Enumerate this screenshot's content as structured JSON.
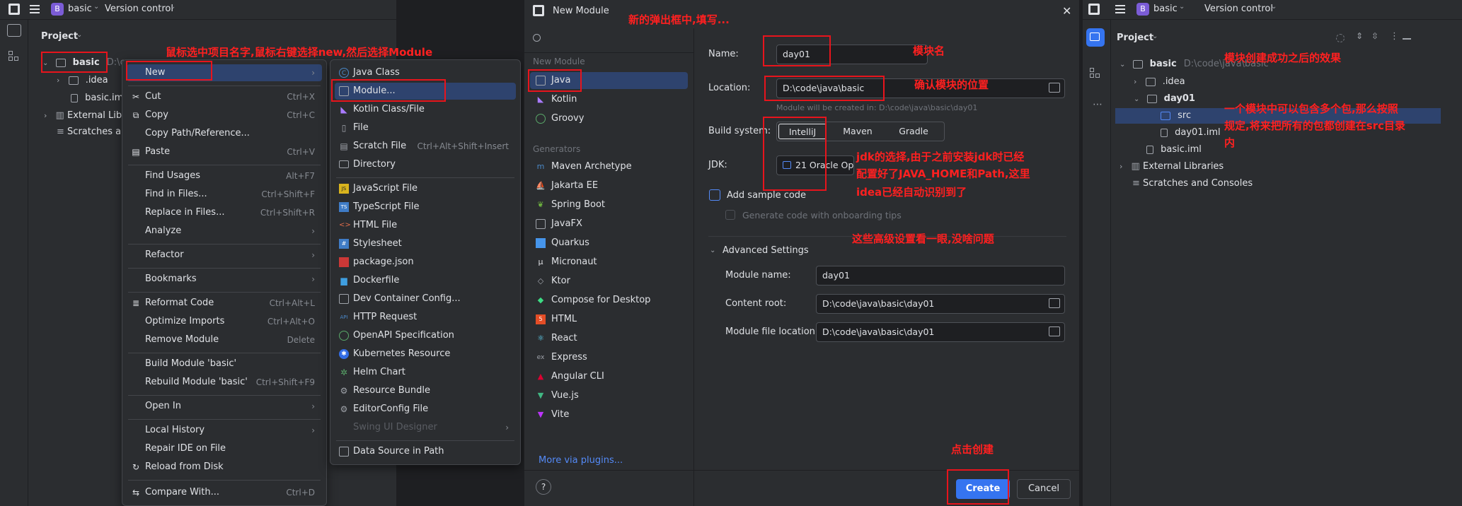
{
  "left_ide": {
    "project_badge": "B",
    "project_name": "basic",
    "vcs": "Version control",
    "panel_title": "Project",
    "tree": [
      {
        "label": "basic",
        "path": "D:\\co"
      },
      {
        "label": ".idea"
      },
      {
        "label": "basic.iml"
      },
      {
        "label": "External Libra"
      },
      {
        "label": "Scratches an"
      }
    ]
  },
  "context_menu": {
    "items": [
      {
        "label": "New",
        "shortcut": "",
        "arrow": "›"
      },
      {
        "label": "Cut",
        "shortcut": "Ctrl+X"
      },
      {
        "label": "Copy",
        "shortcut": "Ctrl+C"
      },
      {
        "label": "Copy Path/Reference...",
        "shortcut": ""
      },
      {
        "label": "Paste",
        "shortcut": "Ctrl+V"
      },
      {
        "label": "Find Usages",
        "shortcut": "Alt+F7"
      },
      {
        "label": "Find in Files...",
        "shortcut": "Ctrl+Shift+F"
      },
      {
        "label": "Replace in Files...",
        "shortcut": "Ctrl+Shift+R"
      },
      {
        "label": "Analyze",
        "shortcut": "",
        "arrow": "›"
      },
      {
        "label": "Refactor",
        "shortcut": "",
        "arrow": "›"
      },
      {
        "label": "Bookmarks",
        "shortcut": "",
        "arrow": "›"
      },
      {
        "label": "Reformat Code",
        "shortcut": "Ctrl+Alt+L"
      },
      {
        "label": "Optimize Imports",
        "shortcut": "Ctrl+Alt+O"
      },
      {
        "label": "Remove Module",
        "shortcut": "Delete"
      },
      {
        "label": "Build Module 'basic'",
        "shortcut": ""
      },
      {
        "label": "Rebuild Module 'basic'",
        "shortcut": "Ctrl+Shift+F9"
      },
      {
        "label": "Open In",
        "shortcut": "",
        "arrow": "›"
      },
      {
        "label": "Local History",
        "shortcut": "",
        "arrow": "›"
      },
      {
        "label": "Repair IDE on File",
        "shortcut": ""
      },
      {
        "label": "Reload from Disk",
        "shortcut": ""
      },
      {
        "label": "Compare With...",
        "shortcut": "Ctrl+D"
      }
    ]
  },
  "new_submenu": {
    "items": [
      {
        "label": "Java Class",
        "shortcut": ""
      },
      {
        "label": "Module...",
        "shortcut": ""
      },
      {
        "label": "Kotlin Class/File",
        "shortcut": ""
      },
      {
        "label": "File",
        "shortcut": ""
      },
      {
        "label": "Scratch File",
        "shortcut": "Ctrl+Alt+Shift+Insert"
      },
      {
        "label": "Directory",
        "shortcut": ""
      },
      {
        "label": "JavaScript File",
        "shortcut": ""
      },
      {
        "label": "TypeScript File",
        "shortcut": ""
      },
      {
        "label": "HTML File",
        "shortcut": ""
      },
      {
        "label": "Stylesheet",
        "shortcut": ""
      },
      {
        "label": "package.json",
        "shortcut": ""
      },
      {
        "label": "Dockerfile",
        "shortcut": ""
      },
      {
        "label": "Dev Container Config...",
        "shortcut": ""
      },
      {
        "label": "HTTP Request",
        "shortcut": ""
      },
      {
        "label": "OpenAPI Specification",
        "shortcut": ""
      },
      {
        "label": "Kubernetes Resource",
        "shortcut": ""
      },
      {
        "label": "Helm Chart",
        "shortcut": ""
      },
      {
        "label": "Resource Bundle",
        "shortcut": ""
      },
      {
        "label": "EditorConfig File",
        "shortcut": ""
      },
      {
        "label": "Swing UI Designer",
        "shortcut": "›"
      },
      {
        "label": "Data Source in Path",
        "shortcut": ""
      }
    ],
    "icons": {
      "java_class": "C",
      "kotlin": "K",
      "file": "▯",
      "js": "JS",
      "ts": "TS",
      "html": "<>",
      "api": "API"
    }
  },
  "dialog": {
    "title": "New Module",
    "search_placeholder": "",
    "section_new": "New Module",
    "new_items": [
      "Java",
      "Kotlin",
      "Groovy"
    ],
    "section_generators": "Generators",
    "generators": [
      "Maven Archetype",
      "Jakarta EE",
      "Spring Boot",
      "JavaFX",
      "Quarkus",
      "Micronaut",
      "Ktor",
      "Compose for Desktop",
      "HTML",
      "React",
      "Express",
      "Angular CLI",
      "Vue.js",
      "Vite"
    ],
    "more_plugins": "More via plugins...",
    "name_label": "Name:",
    "name_value": "day01",
    "location_label": "Location:",
    "location_value": "D:\\code\\java\\basic",
    "location_hint": "Module will be created in: D:\\code\\java\\basic\\day01",
    "build_label": "Build system:",
    "build_options": [
      "IntelliJ",
      "Maven",
      "Gradle"
    ],
    "jdk_label": "JDK:",
    "jdk_value": "21  Oracle Op",
    "sample_code": "Add sample code",
    "onboarding": "Generate code with onboarding tips",
    "advanced": "Advanced Settings",
    "module_name_label": "Module name:",
    "module_name_value": "day01",
    "content_root_label": "Content root:",
    "content_root_value": "D:\\code\\java\\basic\\day01",
    "module_file_label": "Module file location:",
    "module_file_value": "D:\\code\\java\\basic\\day01",
    "help": "?",
    "create": "Create",
    "cancel": "Cancel",
    "close": "✕"
  },
  "right_ide": {
    "project_badge": "B",
    "project_name": "basic",
    "vcs": "Version control",
    "panel_title": "Project",
    "tree": [
      {
        "label": "basic",
        "path": "D:\\code\\java\\basic"
      },
      {
        "label": ".idea"
      },
      {
        "label": "day01"
      },
      {
        "label": "src"
      },
      {
        "label": "day01.iml"
      },
      {
        "label": "basic.iml"
      },
      {
        "label": "External Libraries"
      },
      {
        "label": "Scratches and Consoles"
      }
    ]
  },
  "annotations": {
    "a1": "鼠标选中项目名字,鼠标右键选择new,然后选择Module",
    "a2": "新的弹出框中,填写...",
    "a3": "模块名",
    "a4": "确认模块的位置",
    "a5_l1": "jdk的选择,由于之前安装jdk时已经",
    "a5_l2": "配置好了JAVA_HOME和Path,这里",
    "a5_l3": "idea已经自动识别到了",
    "a6": "这些高级设置看一眼,没啥问题",
    "a7": "点击创建",
    "a8": "模块创建成功之后的效果",
    "a9_l1": "一个模块中可以包含多个包,那么按照",
    "a9_l2": "规定,将来把所有的包都创建在src目录",
    "a9_l3": "内"
  },
  "colors": {
    "accent": "#3574f0",
    "annotation": "#ff2020",
    "box": "#e8141c",
    "selection": "#2e436e"
  }
}
